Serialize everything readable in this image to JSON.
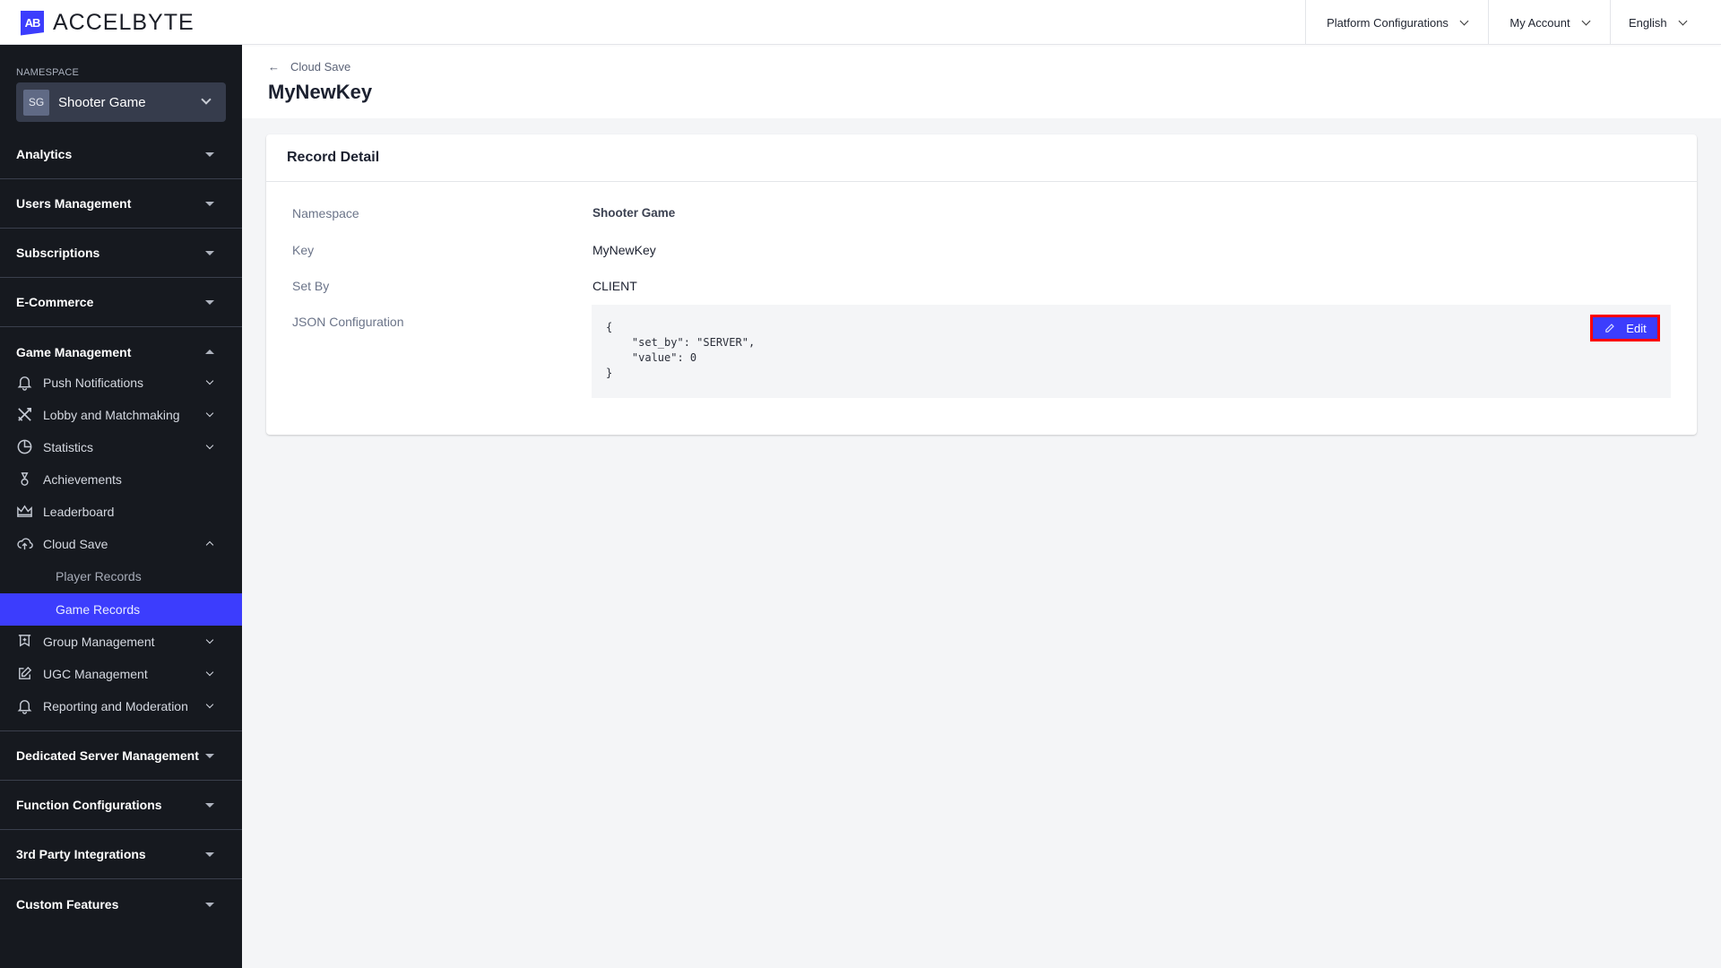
{
  "header": {
    "logo_mark": "AB",
    "brand": "ACCELBYTE",
    "nav": [
      {
        "label": "Platform Configurations"
      },
      {
        "label": "My Account"
      },
      {
        "label": "English"
      }
    ]
  },
  "sidebar": {
    "namespace_label": "NAMESPACE",
    "namespace": {
      "badge": "SG",
      "name": "Shooter Game"
    },
    "sections_top": [
      {
        "label": "Analytics"
      },
      {
        "label": "Users Management"
      },
      {
        "label": "Subscriptions"
      },
      {
        "label": "E-Commerce"
      }
    ],
    "game_management": {
      "label": "Game Management",
      "items": [
        {
          "label": "Push Notifications",
          "icon": "bell-icon"
        },
        {
          "label": "Lobby and Matchmaking",
          "icon": "crossed-swords-icon"
        },
        {
          "label": "Statistics",
          "icon": "pie-chart-icon"
        },
        {
          "label": "Achievements",
          "icon": "medal-icon"
        },
        {
          "label": "Leaderboard",
          "icon": "crown-icon"
        },
        {
          "label": "Cloud Save",
          "icon": "cloud-upload-icon"
        },
        {
          "label": "Group Management",
          "icon": "banner-icon"
        },
        {
          "label": "UGC Management",
          "icon": "edit-square-icon"
        },
        {
          "label": "Reporting and Moderation",
          "icon": "bell-icon"
        }
      ],
      "cloud_save_children": [
        {
          "label": "Player Records"
        },
        {
          "label": "Game Records",
          "active": true
        }
      ]
    },
    "sections_bottom": [
      {
        "label": "Dedicated Server Management"
      },
      {
        "label": "Function Configurations"
      },
      {
        "label": "3rd Party Integrations"
      },
      {
        "label": "Custom Features"
      }
    ]
  },
  "page": {
    "back_label": "Cloud Save",
    "title": "MyNewKey"
  },
  "record": {
    "title": "Record Detail",
    "fields": [
      {
        "label": "Namespace",
        "value": "Shooter Game"
      },
      {
        "label": "Key",
        "value": "MyNewKey"
      },
      {
        "label": "Set By",
        "value": "CLIENT"
      },
      {
        "label": "JSON Configuration",
        "value": "{\n    \"set_by\": \"SERVER\",\n    \"value\": 0\n}"
      }
    ],
    "edit_label": "Edit"
  },
  "colors": {
    "accent": "#3c3dfd",
    "sidebar_bg": "#16191f",
    "highlight_border": "#ff0000"
  }
}
